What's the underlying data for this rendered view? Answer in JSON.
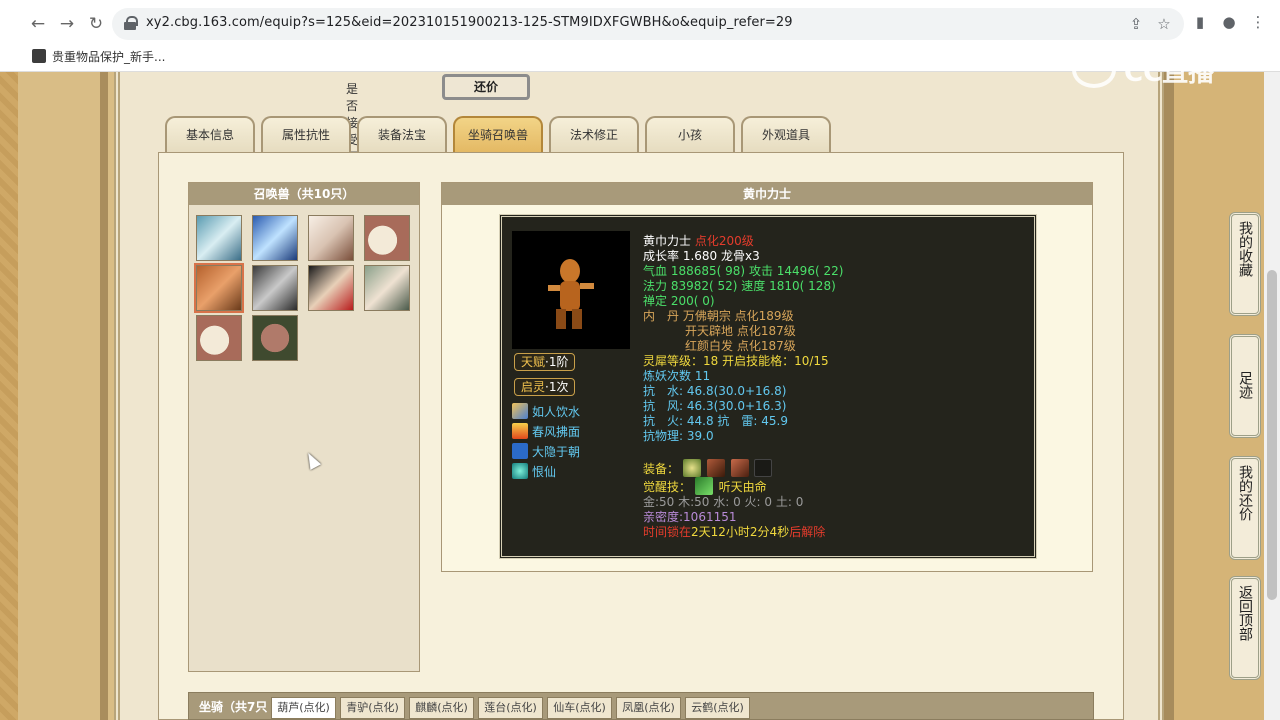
{
  "browser": {
    "url": "xy2.cbg.163.com/equip?s=125&eid=202310151900213-125-STM9IDXFGWBH&o&equip_refer=29",
    "bookmark_label": "贵重物品保护_新手..."
  },
  "watermark": "CC直播",
  "offer": {
    "label": "是否接受还价:",
    "button": "还价"
  },
  "tabs": [
    {
      "label": "基本信息",
      "active": false
    },
    {
      "label": "属性抗性",
      "active": false
    },
    {
      "label": "装备法宝",
      "active": false
    },
    {
      "label": "坐骑召唤兽",
      "active": true
    },
    {
      "label": "法术修正",
      "active": false
    },
    {
      "label": "小孩",
      "active": false
    },
    {
      "label": "外观道具",
      "active": false
    }
  ],
  "summon_panel": {
    "title": "召唤兽（共10只）",
    "count": 10
  },
  "detail_panel": {
    "title": "黄巾力士"
  },
  "pet": {
    "name": "黄巾力士",
    "level": "点化200级",
    "growth": "成长率 1.680 龙骨x3",
    "hp_label": "气血",
    "hp": "188685( 98)",
    "atk_label": "攻击",
    "atk": "14496( 22)",
    "mp_label": "法力",
    "mp": "83982( 52)",
    "spd_label": "速度",
    "spd": "1810( 128)",
    "zen_label": "禅定",
    "zen": "200( 0)",
    "neidan_label": "内　丹",
    "neidan": [
      "万佛朝宗 点化189级",
      "开天辟地 点化187级",
      "红颜白发 点化187级"
    ],
    "soul_level": "灵犀等级：18 开启技能格：10/15",
    "refine": "炼妖次数 11",
    "res_water": "抗　水: 46.8(30.0+16.8)",
    "res_wind": "抗　风: 46.3(30.0+16.3)",
    "res_fire_thunder": "抗　火: 44.8 抗　雷: 45.9",
    "res_physical": "抗物理: 39.0",
    "equip_label": "装备：",
    "awaken_label": "觉醒技：",
    "awaken_skill": "听天由命",
    "elements": "金:50 木:50 水: 0 火: 0 土: 0",
    "intimacy": "亲密度:1061151",
    "lock_prefix": "时间锁在",
    "lock_time": "2天12小时2分4秒",
    "lock_suffix": "后解除",
    "talent_label": "天赋",
    "talent_value": "·1阶",
    "spirit_label": "启灵",
    "spirit_value": "·1次",
    "skills": [
      "如人饮水",
      "春风拂面",
      "大隐于朝",
      "恨仙"
    ]
  },
  "side_buttons": [
    "我的收藏",
    "足迹",
    "我的还价",
    "返回顶部"
  ],
  "mount_bar": {
    "title": "坐骑（共7只",
    "tabs": [
      "葫芦(点化)",
      "青驴(点化)",
      "麒麟(点化)",
      "莲台(点化)",
      "仙车(点化)",
      "凤凰(点化)",
      "云鹤(点化)"
    ]
  }
}
